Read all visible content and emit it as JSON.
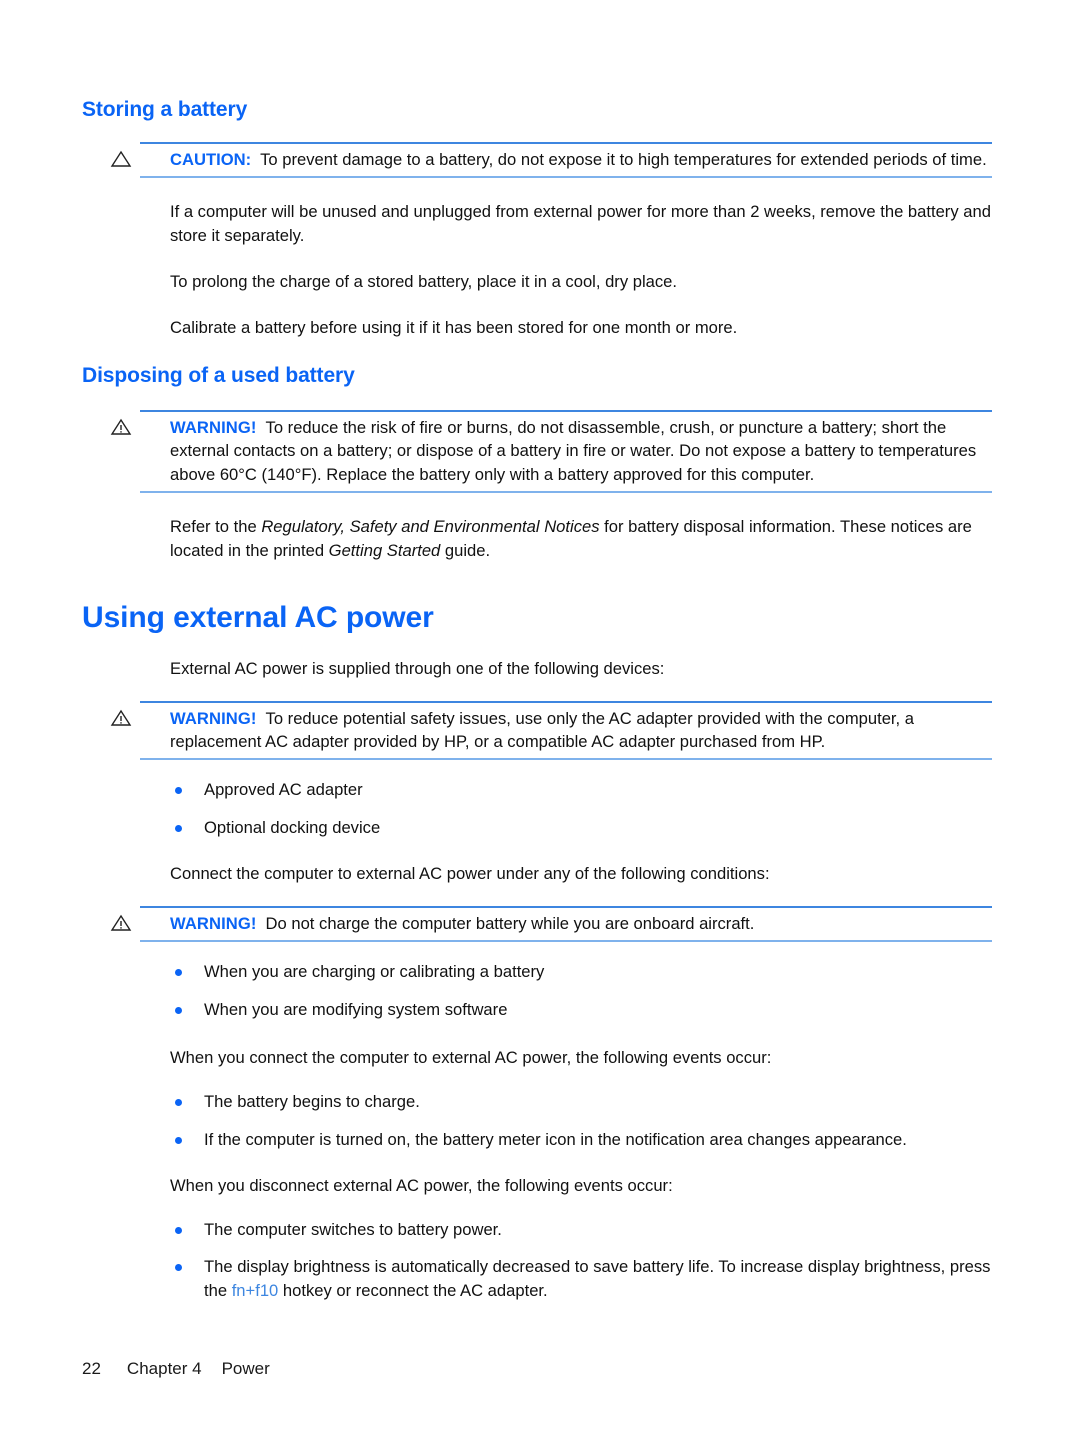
{
  "page": {
    "footer": {
      "page_number": "22",
      "chapter": "Chapter 4",
      "section": "Power"
    },
    "accent_color": "#0a64f5",
    "rule_color": "#4a90e2"
  },
  "sections": {
    "storing_battery": {
      "heading": "Storing a battery",
      "caution": {
        "icon": "caution-triangle-icon",
        "label": "CAUTION:",
        "text": "To prevent damage to a battery, do not expose it to high temperatures for extended periods of time."
      },
      "paragraphs": [
        "If a computer will be unused and unplugged from external power for more than 2 weeks, remove the battery and store it separately.",
        "To prolong the charge of a stored battery, place it in a cool, dry place.",
        "Calibrate a battery before using it if it has been stored for one month or more."
      ]
    },
    "disposing_battery": {
      "heading": "Disposing of a used battery",
      "warning": {
        "icon": "warning-triangle-icon",
        "label": "WARNING!",
        "text": "To reduce the risk of fire or burns, do not disassemble, crush, or puncture a battery; short the external contacts on a battery; or dispose of a battery in fire or water. Do not expose a battery to temperatures above 60°C (140°F). Replace the battery only with a battery approved for this computer."
      },
      "refer_paragraph": {
        "prefix": "Refer to the ",
        "italic_1": "Regulatory, Safety and Environmental Notices",
        "middle": " for battery disposal information. These notices are located in the printed ",
        "italic_2": "Getting Started",
        "suffix": " guide."
      }
    },
    "using_external_ac": {
      "heading": "Using external AC power",
      "intro": "External AC power is supplied through one of the following devices:",
      "warning_adapter": {
        "icon": "warning-triangle-icon",
        "label": "WARNING!",
        "text": "To reduce potential safety issues, use only the AC adapter provided with the computer, a replacement AC adapter provided by HP, or a compatible AC adapter purchased from HP."
      },
      "device_bullets": [
        "Approved AC adapter",
        "Optional docking device"
      ],
      "connect_intro": "Connect the computer to external AC power under any of the following conditions:",
      "warning_aircraft": {
        "icon": "warning-triangle-icon",
        "label": "WARNING!",
        "text": "Do not charge the computer battery while you are onboard aircraft."
      },
      "condition_bullets": [
        "When you are charging or calibrating a battery",
        "When you are modifying system software"
      ],
      "connect_events_intro": "When you connect the computer to external AC power, the following events occur:",
      "connect_event_bullets": [
        "The battery begins to charge.",
        "If the computer is turned on, the battery meter icon in the notification area changes appearance."
      ],
      "disconnect_events_intro": "When you disconnect external AC power, the following events occur:",
      "disconnect_event_bullets": [
        {
          "text": "The computer switches to battery power.",
          "hotkey": null
        },
        {
          "prefix": "The display brightness is automatically decreased to save battery life. To increase display brightness, press the ",
          "hotkey": "fn+f10",
          "suffix": " hotkey or reconnect the AC adapter."
        }
      ]
    }
  }
}
